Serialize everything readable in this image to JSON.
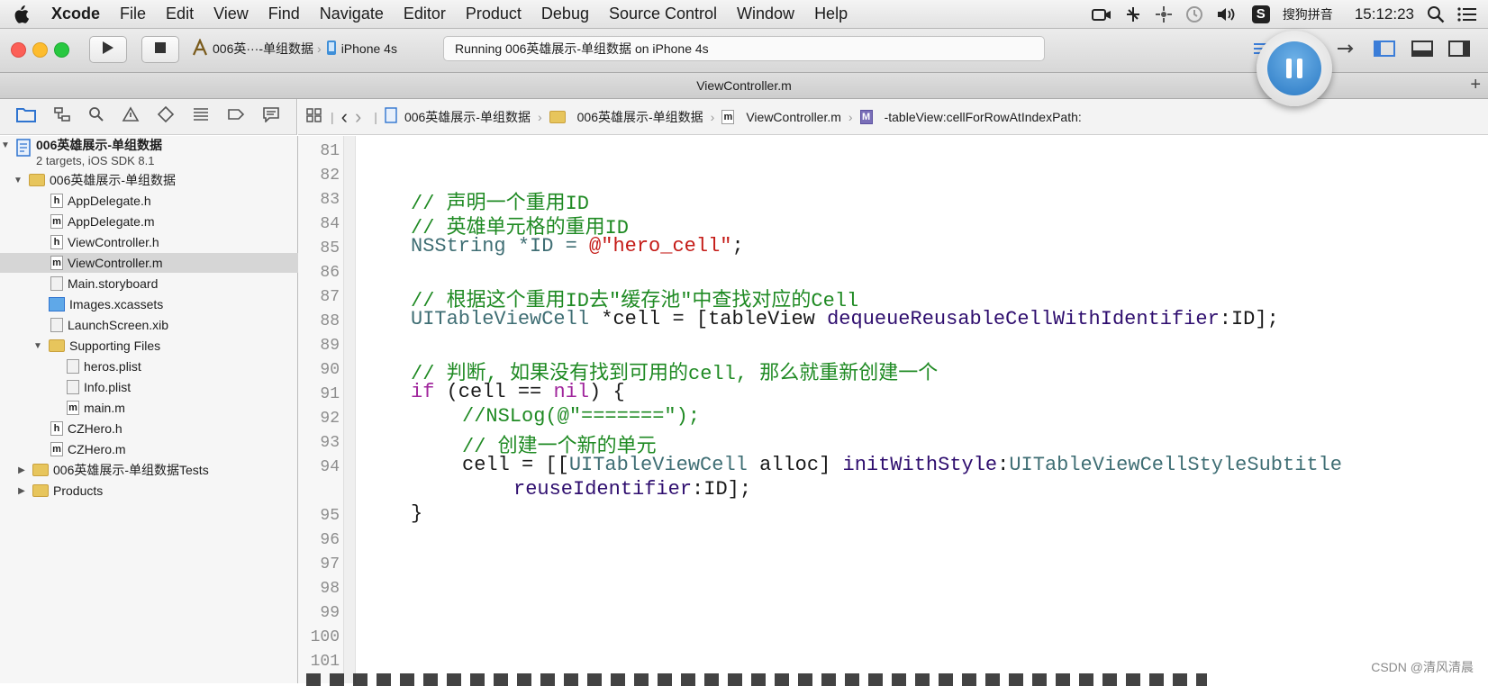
{
  "menubar": {
    "items": [
      "Xcode",
      "File",
      "Edit",
      "View",
      "Find",
      "Navigate",
      "Editor",
      "Product",
      "Debug",
      "Source Control",
      "Window",
      "Help"
    ],
    "input_method": "搜狗拼音",
    "clock": "15:12:23"
  },
  "toolbar": {
    "scheme": "006英···-单组数据",
    "device": "iPhone 4s",
    "activity": "Running 006英雄展示-单组数据 on iPhone 4s"
  },
  "tab": {
    "title": "ViewController.m",
    "add": "+"
  },
  "jumpbar": {
    "crumbs": [
      "006英雄展示-单组数据",
      "006英雄展示-单组数据",
      "ViewController.m",
      "-tableView:cellForRowAtIndexPath:"
    ]
  },
  "navigator": {
    "project": {
      "name": "006英雄展示-单组数据",
      "subtitle": "2 targets, iOS SDK 8.1"
    },
    "items": [
      {
        "label": "006英雄展示-单组数据",
        "kind": "folder",
        "badge": ""
      },
      {
        "label": "AppDelegate.h",
        "kind": "file",
        "badge": "h"
      },
      {
        "label": "AppDelegate.m",
        "kind": "file",
        "badge": "m"
      },
      {
        "label": "ViewController.h",
        "kind": "file",
        "badge": "h"
      },
      {
        "label": "ViewController.m",
        "kind": "file",
        "badge": "m"
      },
      {
        "label": "Main.storyboard",
        "kind": "file",
        "badge": ""
      },
      {
        "label": "Images.xcassets",
        "kind": "file",
        "badge": ""
      },
      {
        "label": "LaunchScreen.xib",
        "kind": "file",
        "badge": ""
      },
      {
        "label": "Supporting Files",
        "kind": "folder",
        "badge": ""
      },
      {
        "label": "heros.plist",
        "kind": "file",
        "badge": ""
      },
      {
        "label": "Info.plist",
        "kind": "file",
        "badge": ""
      },
      {
        "label": "main.m",
        "kind": "file",
        "badge": "m"
      },
      {
        "label": "CZHero.h",
        "kind": "file",
        "badge": "h"
      },
      {
        "label": "CZHero.m",
        "kind": "file",
        "badge": "m"
      },
      {
        "label": "006英雄展示-单组数据Tests",
        "kind": "folder",
        "badge": ""
      },
      {
        "label": "Products",
        "kind": "folder",
        "badge": ""
      }
    ]
  },
  "editor": {
    "line_numbers": [
      "81",
      "82",
      "83",
      "84",
      "85",
      "86",
      "87",
      "88",
      "89",
      "90",
      "91",
      "92",
      "93",
      "94",
      "95",
      "96",
      "97",
      "98",
      "99",
      "100",
      "101"
    ],
    "code": {
      "l83": "// 声明一个重用ID",
      "l84": "// 英雄单元格的重用ID",
      "l85a": "NSString *ID = ",
      "l85b": "@\"hero_cell\"",
      "l85c": ";",
      "l87": "// 根据这个重用ID去\"缓存池\"中查找对应的Cell",
      "l88a": "UITableViewCell",
      "l88b": " *cell = [tableView ",
      "l88c": "dequeueReusableCellWithIdentifier",
      "l88d": ":ID];",
      "l90": "// 判断, 如果没有找到可用的cell, 那么就重新创建一个",
      "l91a": "if",
      "l91b": " (cell == ",
      "l91c": "nil",
      "l91d": ") {",
      "l92": "//NSLog(@\"=======\");",
      "l93": "// 创建一个新的单元",
      "l94a": "cell = [[",
      "l94b": "UITableViewCell",
      "l94c": " alloc] ",
      "l94d": "initWithStyle",
      "l94e": ":",
      "l94f": "UITableViewCellStyleSubtitle",
      "l94g": "reuseIdentifier",
      "l94h": ":ID];",
      "l95": "}"
    }
  },
  "watermark": "CSDN @清风清晨"
}
